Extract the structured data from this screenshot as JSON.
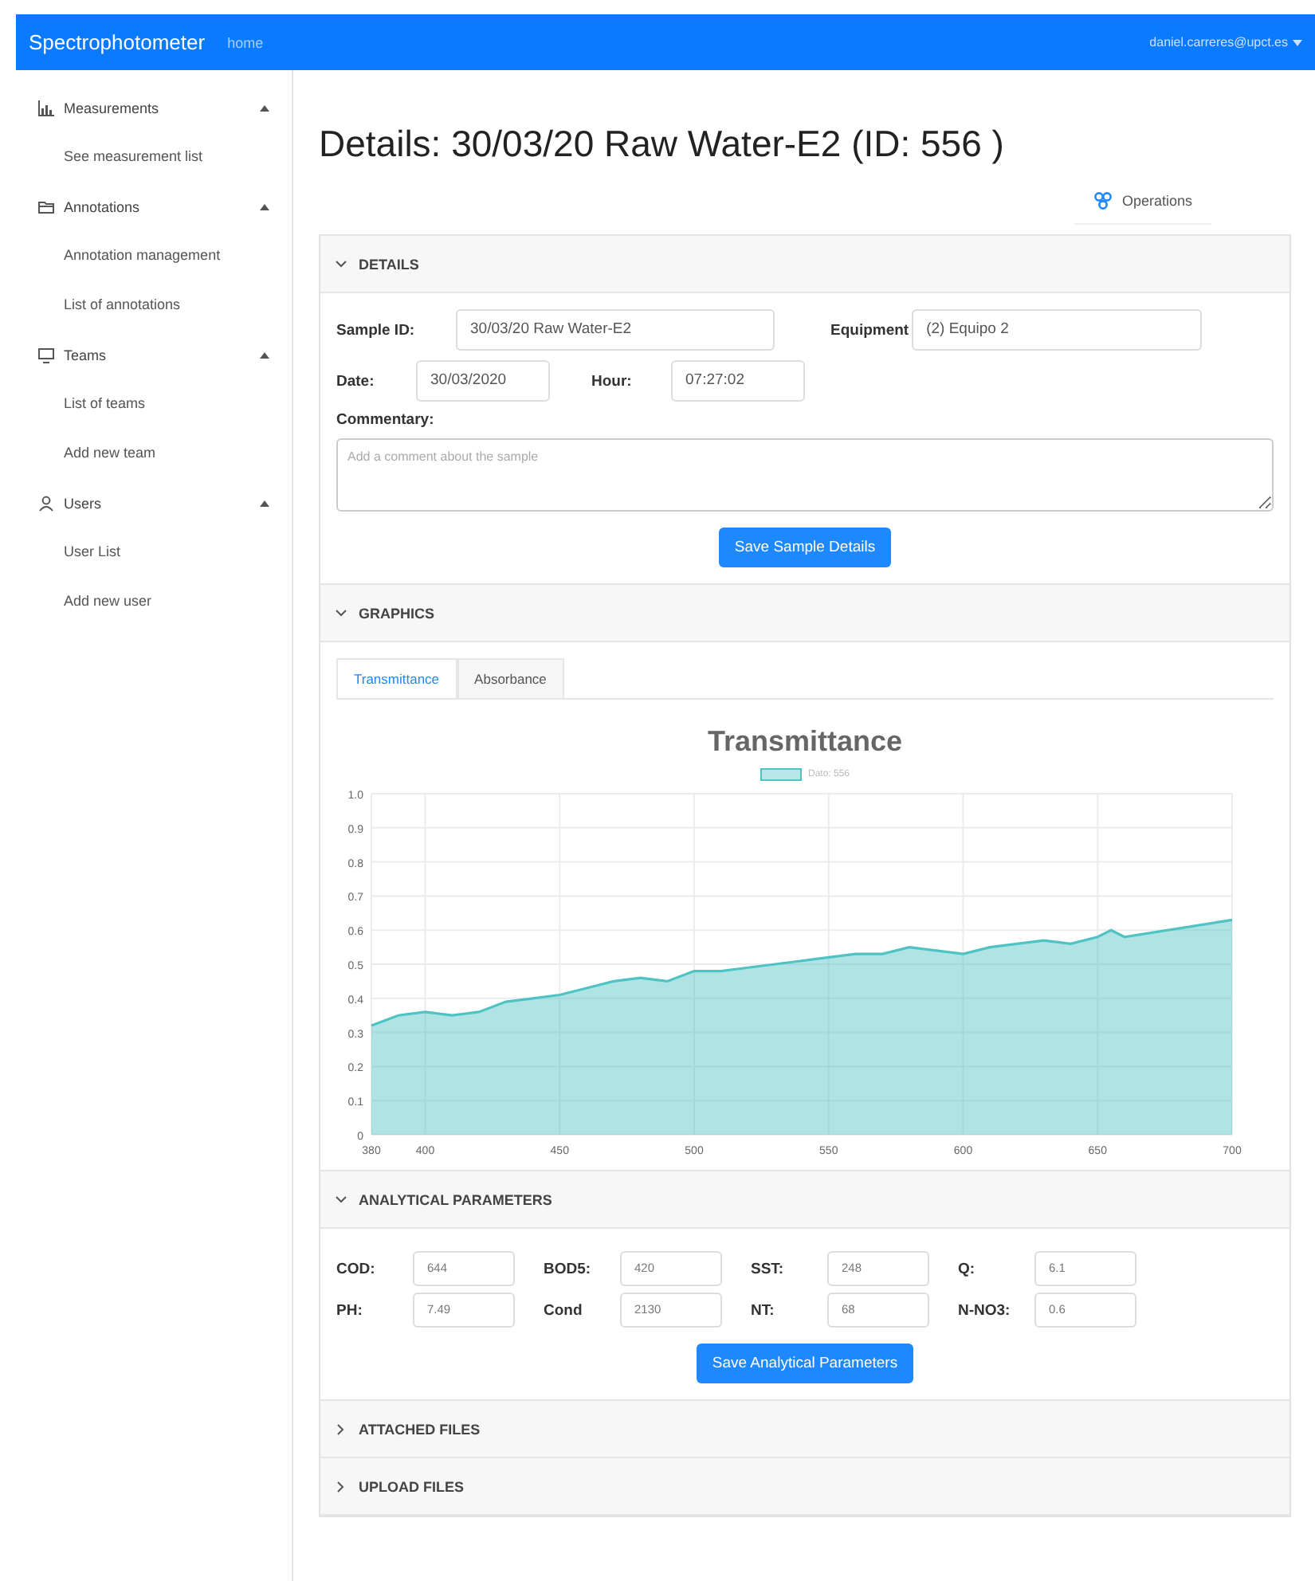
{
  "navbar": {
    "brand": "Spectrophotometer",
    "link": "home",
    "user": "daniel.carreres@upct.es"
  },
  "sidebar": {
    "groups": [
      {
        "label": "Measurements",
        "expanded": true,
        "items": [
          "See measurement list"
        ]
      },
      {
        "label": "Annotations",
        "expanded": true,
        "items": [
          "Annotation management",
          "List of annotations"
        ]
      },
      {
        "label": "Teams",
        "expanded": true,
        "items": [
          "List of teams",
          "Add new team"
        ]
      },
      {
        "label": "Users",
        "expanded": true,
        "items": [
          "User List",
          "Add new user"
        ]
      }
    ]
  },
  "title": "Details: 30/03/20 Raw Water-E2 (ID: 556 )",
  "operations": "Operations",
  "details": {
    "header": "DETAILS",
    "expanded": true,
    "sample_id": {
      "label": "Sample ID:",
      "value": "30/03/20 Raw Water-E2"
    },
    "equipment": {
      "label": "Equipment",
      "value": "(2) Equipo 2"
    },
    "date": {
      "label": "Date:",
      "value": "30/03/2020"
    },
    "hour": {
      "label": "Hour:",
      "value": "07:27:02"
    },
    "commentary": {
      "label": "Commentary:",
      "placeholder": "Add a comment about the sample"
    },
    "button": "Save Sample Details"
  },
  "graphics": {
    "header": "GRAPHICS",
    "expanded": true,
    "tabs": [
      {
        "label": "Transmittance",
        "selected": true
      },
      {
        "label": "Absorbance",
        "selected": false
      }
    ],
    "chart_data": {
      "type": "area",
      "title": "Transmittance",
      "x": [
        380,
        390,
        400,
        410,
        420,
        430,
        440,
        450,
        460,
        470,
        480,
        490,
        500,
        510,
        520,
        530,
        540,
        550,
        560,
        570,
        580,
        590,
        600,
        610,
        620,
        630,
        640,
        650,
        655,
        660,
        700
      ],
      "series": [
        {
          "name": "Dato: 556",
          "color": "#4fc3c3",
          "values": [
            0.32,
            0.35,
            0.36,
            0.35,
            0.36,
            0.39,
            0.4,
            0.41,
            0.43,
            0.45,
            0.46,
            0.45,
            0.48,
            0.48,
            0.49,
            0.5,
            0.51,
            0.52,
            0.53,
            0.53,
            0.55,
            0.54,
            0.53,
            0.55,
            0.56,
            0.57,
            0.56,
            0.58,
            0.6,
            0.58,
            0.63
          ]
        }
      ],
      "xlim": [
        380,
        700
      ],
      "ylim": [
        0,
        1
      ],
      "grid": true,
      "xticks": [
        380,
        400,
        450,
        500,
        550,
        600,
        650,
        700
      ],
      "yticks": [
        {
          "value": 0,
          "label": "0"
        },
        0.1,
        0.2,
        0.3,
        0.4,
        0.5,
        0.6,
        0.7,
        0.8,
        0.9,
        {
          "value": 1,
          "label": "1.0"
        }
      ]
    }
  },
  "analytical": {
    "header": "ANALYTICAL PARAMETERS",
    "expanded": true,
    "params": [
      {
        "label": "COD:",
        "value": "644"
      },
      {
        "label": "BOD5:",
        "value": "420"
      },
      {
        "label": "SST:",
        "value": "248"
      },
      {
        "label": "Q:",
        "value": "6.1"
      },
      {
        "label": "PH:",
        "value": "7.49"
      },
      {
        "label": "Cond",
        "value": "2130"
      },
      {
        "label": "NT:",
        "value": "68"
      },
      {
        "label": "N-NO3:",
        "value": "0.6"
      }
    ],
    "button": "Save Analytical Parameters"
  },
  "collapsed_sections": [
    {
      "header": "ATTACHED FILES",
      "expanded": false
    },
    {
      "header": "UPLOAD FILES",
      "expanded": false
    }
  ]
}
